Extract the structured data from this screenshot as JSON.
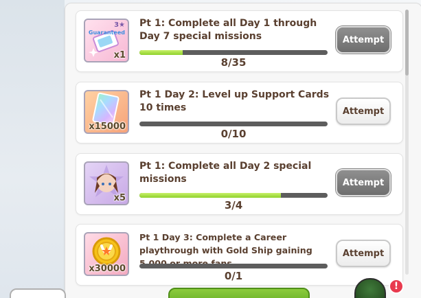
{
  "missions": [
    {
      "title": "Pt 1: Complete all Day 1 through Day 7 special missions",
      "progress_text": "8/35",
      "progress_fraction": 0.229,
      "reward": {
        "icon": "guaranteed-ticket-icon",
        "quantity": "x1",
        "badge": "3★",
        "badge_sub": "Guaranteed"
      },
      "button_label": "Attempt",
      "button_style": "grey"
    },
    {
      "title": "Pt 1 Day 2: Level up Support Cards 10 times",
      "progress_text": "0/10",
      "progress_fraction": 0,
      "reward": {
        "icon": "rainbow-card-icon",
        "quantity": "x15000"
      },
      "button_label": "Attempt",
      "button_style": "white"
    },
    {
      "title": "Pt 1: Complete all Day 2 special missions",
      "progress_text": "3/4",
      "progress_fraction": 0.75,
      "reward": {
        "icon": "character-portrait-icon",
        "quantity": "x5"
      },
      "button_label": "Attempt",
      "button_style": "grey"
    },
    {
      "title": "Pt 1 Day 3: Complete a Career playthrough with Gold Ship gaining 5,000 or more fans",
      "progress_text": "0/1",
      "progress_fraction": 0,
      "reward": {
        "icon": "gold-coin-icon",
        "quantity": "x30000"
      },
      "button_label": "Attempt",
      "button_style": "white"
    }
  ],
  "notification_badge": "!",
  "colors": {
    "progress_fill": "#8fd12c",
    "progress_track": "#5d5d5d",
    "title_text": "#5a4030",
    "button_grey": "#7b7b7b",
    "notification": "#e83a4e"
  }
}
